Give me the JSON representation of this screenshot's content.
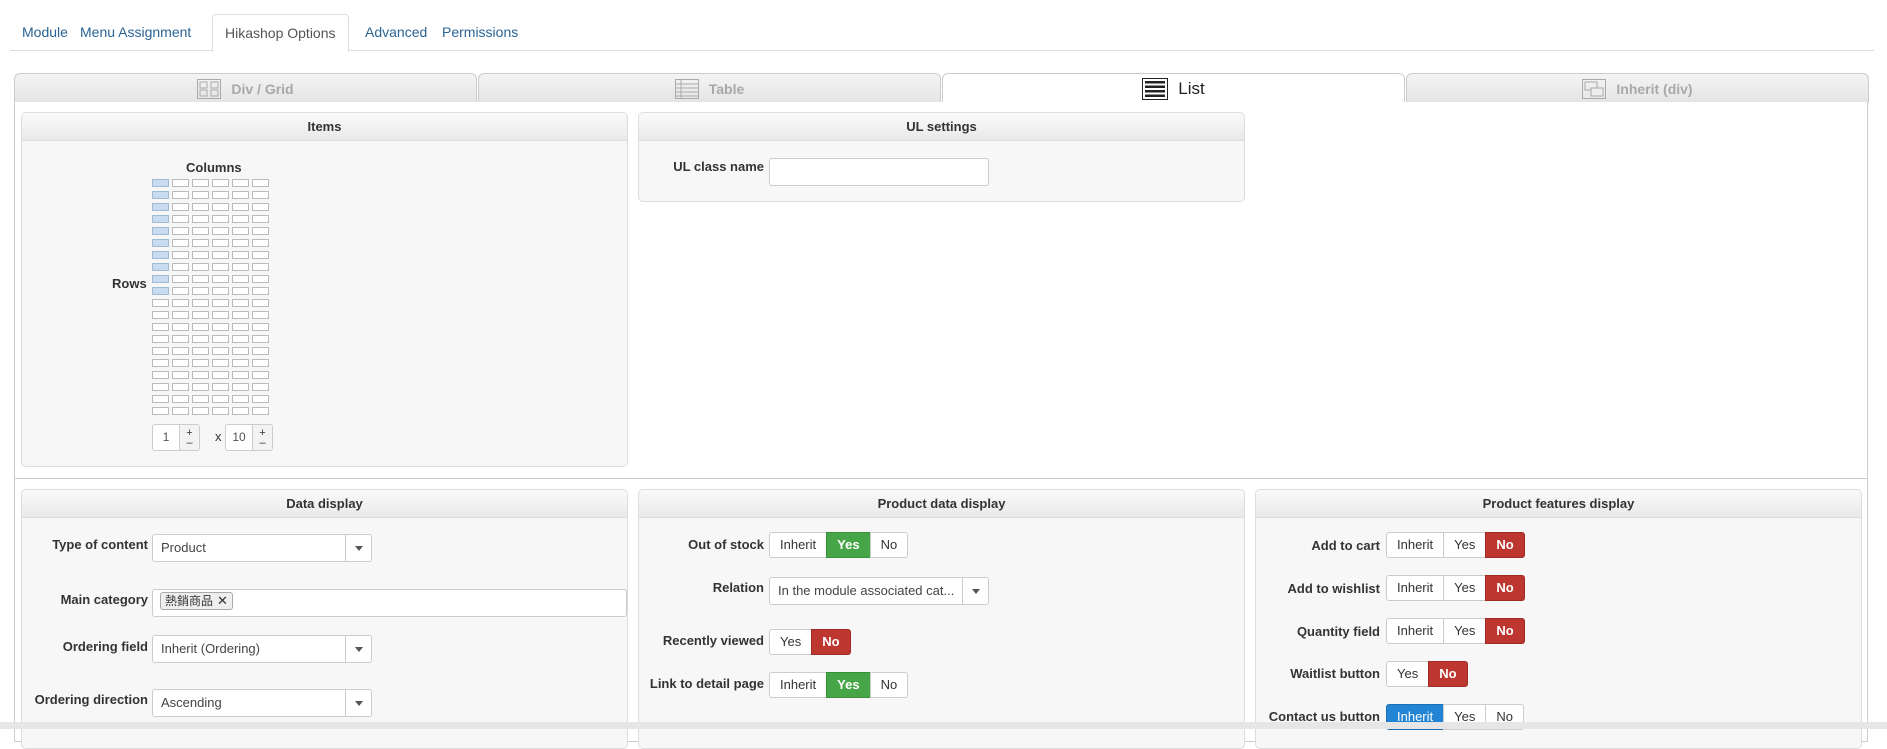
{
  "top_tabs": [
    {
      "label": "Module"
    },
    {
      "label": "Menu Assignment"
    },
    {
      "label": "Hikashop Options"
    },
    {
      "label": "Advanced"
    },
    {
      "label": "Permissions"
    }
  ],
  "layout_tabs": [
    {
      "label": "Div / Grid",
      "icon": "grid-icon"
    },
    {
      "label": "Table",
      "icon": "table-icon"
    },
    {
      "label": "List",
      "icon": "list-icon"
    },
    {
      "label": "Inherit (div)",
      "icon": "inherit-icon"
    }
  ],
  "items_panel": {
    "title": "Items",
    "columns_label": "Columns",
    "rows_label": "Rows",
    "columns_value": "1",
    "rows_value": "10",
    "times": "x",
    "plus": "+",
    "minus": "–"
  },
  "ul_panel": {
    "title": "UL settings",
    "class_label": "UL class name",
    "class_value": ""
  },
  "data_display": {
    "title": "Data display",
    "type_label": "Type of content",
    "type_value": "Product",
    "category_label": "Main category",
    "category_tag": "熱銷商品",
    "ordering_label": "Ordering field",
    "ordering_value": "Inherit (Ordering)",
    "direction_label": "Ordering direction",
    "direction_value": "Ascending"
  },
  "product_data": {
    "title": "Product data display",
    "out_of_stock": {
      "label": "Out of stock",
      "options": [
        "Inherit",
        "Yes",
        "No"
      ]
    },
    "relation": {
      "label": "Relation",
      "value": "In the module associated cat..."
    },
    "recently_viewed": {
      "label": "Recently viewed",
      "options": [
        "Yes",
        "No"
      ]
    },
    "link_detail": {
      "label": "Link to detail page",
      "options": [
        "Inherit",
        "Yes",
        "No"
      ]
    }
  },
  "product_features": {
    "title": "Product features display",
    "add_to_cart": {
      "label": "Add to cart",
      "options": [
        "Inherit",
        "Yes",
        "No"
      ]
    },
    "add_to_wishlist": {
      "label": "Add to wishlist",
      "options": [
        "Inherit",
        "Yes",
        "No"
      ]
    },
    "quantity_field": {
      "label": "Quantity field",
      "options": [
        "Inherit",
        "Yes",
        "No"
      ]
    },
    "waitlist_button": {
      "label": "Waitlist button",
      "options": [
        "Yes",
        "No"
      ]
    },
    "contact_us_button": {
      "label": "Contact us button",
      "options": [
        "Inherit",
        "Yes",
        "No"
      ]
    }
  },
  "colors": {
    "green": "#46a546",
    "red": "#bd362f",
    "blue": "#2384d3",
    "link": "#2a6496"
  }
}
